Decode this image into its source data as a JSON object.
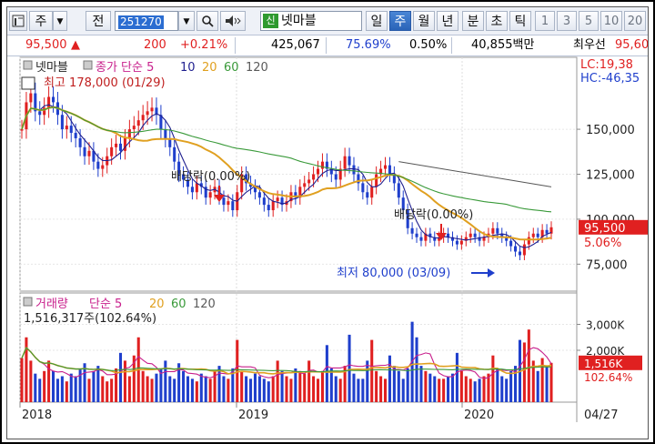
{
  "toolbar": {
    "market": "주",
    "view": "전",
    "code": "251270",
    "badge": "신",
    "name": "넷마블",
    "periods": [
      "일",
      "주",
      "월",
      "년",
      "분",
      "초",
      "틱"
    ],
    "selected_period": "주",
    "minutes": [
      "1",
      "3",
      "5",
      "10",
      "20"
    ],
    "icons": [
      "chart-layout-icon",
      "dropdown-arrow-icon",
      "search-icon",
      "speaker-icon"
    ]
  },
  "quote": {
    "price": "95,500",
    "direction": "▲",
    "change": "200",
    "change_pct": "+0.21%",
    "volume": "425,067",
    "pct_a": "75.69%",
    "pct_b": "0.50%",
    "amount": "40,855백만",
    "ask_label": "최우선",
    "ask_value": "95,60"
  },
  "colors": {
    "up": "#e02020",
    "down": "#1f3fcc",
    "ma5": "#1f1f8f",
    "ma20": "#e0a020",
    "ma60": "#3a9a3a",
    "ma120": "#5a5a5a",
    "vol_ma5": "#c8208c"
  },
  "chart_data": [
    {
      "type": "candlestick",
      "title": "넷마블",
      "legend": {
        "series_label": "종가 단순",
        "periods": [
          "5",
          "10",
          "20",
          "60",
          "120"
        ]
      },
      "ylim": [
        60000,
        190000
      ],
      "y_ticks": [
        "150,000",
        "125,000",
        "100,000",
        "75,000"
      ],
      "x_labels": [
        "2018",
        "2019",
        "2020"
      ],
      "corner_labels": {
        "lc": "LC:19,38",
        "hc": "HC:-46,35"
      },
      "current_price_label": "95,500",
      "current_change_label": "5.06%",
      "annotations": [
        {
          "text": "최고 178,000 (01/29)",
          "date": "2018-01-29",
          "value": 178000
        },
        {
          "text": "배당락(0.00%)",
          "date": "2018-12-27"
        },
        {
          "text": "배당락(0.00%)",
          "date": "2019-12-27"
        },
        {
          "text": "최저 80,000 (03/09)",
          "date": "2020-03-09",
          "value": 80000
        }
      ],
      "trend_line": {
        "from": {
          "date": "2019-08",
          "value": 132000
        },
        "to": {
          "date": "2020-03",
          "value": 118000
        }
      },
      "weekly_close": [
        150000,
        165000,
        170000,
        160000,
        158000,
        162000,
        168000,
        165000,
        158000,
        150000,
        152000,
        148000,
        145000,
        140000,
        135000,
        138000,
        132000,
        128000,
        130000,
        135000,
        140000,
        142000,
        138000,
        145000,
        150000,
        152000,
        155000,
        158000,
        160000,
        162000,
        158000,
        150000,
        145000,
        140000,
        132000,
        125000,
        122000,
        118000,
        115000,
        120000,
        118000,
        112000,
        115000,
        118000,
        112000,
        108000,
        110000,
        105000,
        115000,
        125000,
        120000,
        118000,
        115000,
        112000,
        108000,
        105000,
        110000,
        112000,
        108000,
        110000,
        115000,
        112000,
        118000,
        120000,
        122000,
        125000,
        128000,
        132000,
        128000,
        125000,
        122000,
        128000,
        135000,
        130000,
        125000,
        120000,
        115000,
        112000,
        118000,
        125000,
        128000,
        130000,
        125000,
        120000,
        112000,
        105000,
        95000,
        92000,
        90000,
        88000,
        92000,
        90000,
        88000,
        90000,
        92000,
        90000,
        88000,
        86000,
        88000,
        90000,
        92000,
        90000,
        88000,
        90000,
        92000,
        95000,
        92000,
        90000,
        88000,
        85000,
        82000,
        80000,
        86000,
        90000,
        92000,
        90000,
        94000,
        92000,
        95500
      ]
    },
    {
      "type": "bar",
      "title": "거래량",
      "legend": {
        "series_label": "단순",
        "periods": [
          "5",
          "20",
          "60",
          "120"
        ]
      },
      "summary_label": "1,516,317주(102.64%)",
      "ylim": [
        0,
        4000
      ],
      "y_ticks": [
        "3,000K",
        "2,000K"
      ],
      "current_label": "1,516K",
      "current_pct": "102.64%",
      "x_labels": [
        "2018",
        "2019",
        "2020"
      ],
      "date_label": "04/27",
      "volume_k": [
        1700,
        2500,
        1600,
        1100,
        900,
        1200,
        1600,
        1200,
        900,
        1000,
        800,
        1100,
        1000,
        1300,
        1500,
        900,
        1200,
        1400,
        1000,
        800,
        900,
        1300,
        1900,
        1600,
        1000,
        1800,
        2500,
        1200,
        1000,
        900,
        1100,
        1300,
        1600,
        1000,
        900,
        1500,
        1200,
        1000,
        900,
        800,
        1100,
        1000,
        900,
        1200,
        1400,
        1000,
        900,
        1300,
        2400,
        1200,
        1000,
        900,
        1100,
        1000,
        900,
        800,
        1000,
        1600,
        1200,
        1000,
        900,
        1300,
        1200,
        1100,
        1600,
        1000,
        900,
        1200,
        2200,
        1300,
        1000,
        900,
        1400,
        2600,
        1100,
        900,
        900,
        1600,
        2400,
        1200,
        1000,
        900,
        1800,
        1400,
        1200,
        900,
        1300,
        3100,
        2500,
        1400,
        1200,
        1100,
        1000,
        900,
        900,
        1000,
        1100,
        1900,
        1200,
        1000,
        900,
        800,
        900,
        1000,
        1100,
        1800,
        1300,
        1000,
        900,
        1200,
        1400,
        2400,
        2300,
        2800,
        1600,
        1200,
        1700,
        1400,
        1516
      ]
    }
  ]
}
